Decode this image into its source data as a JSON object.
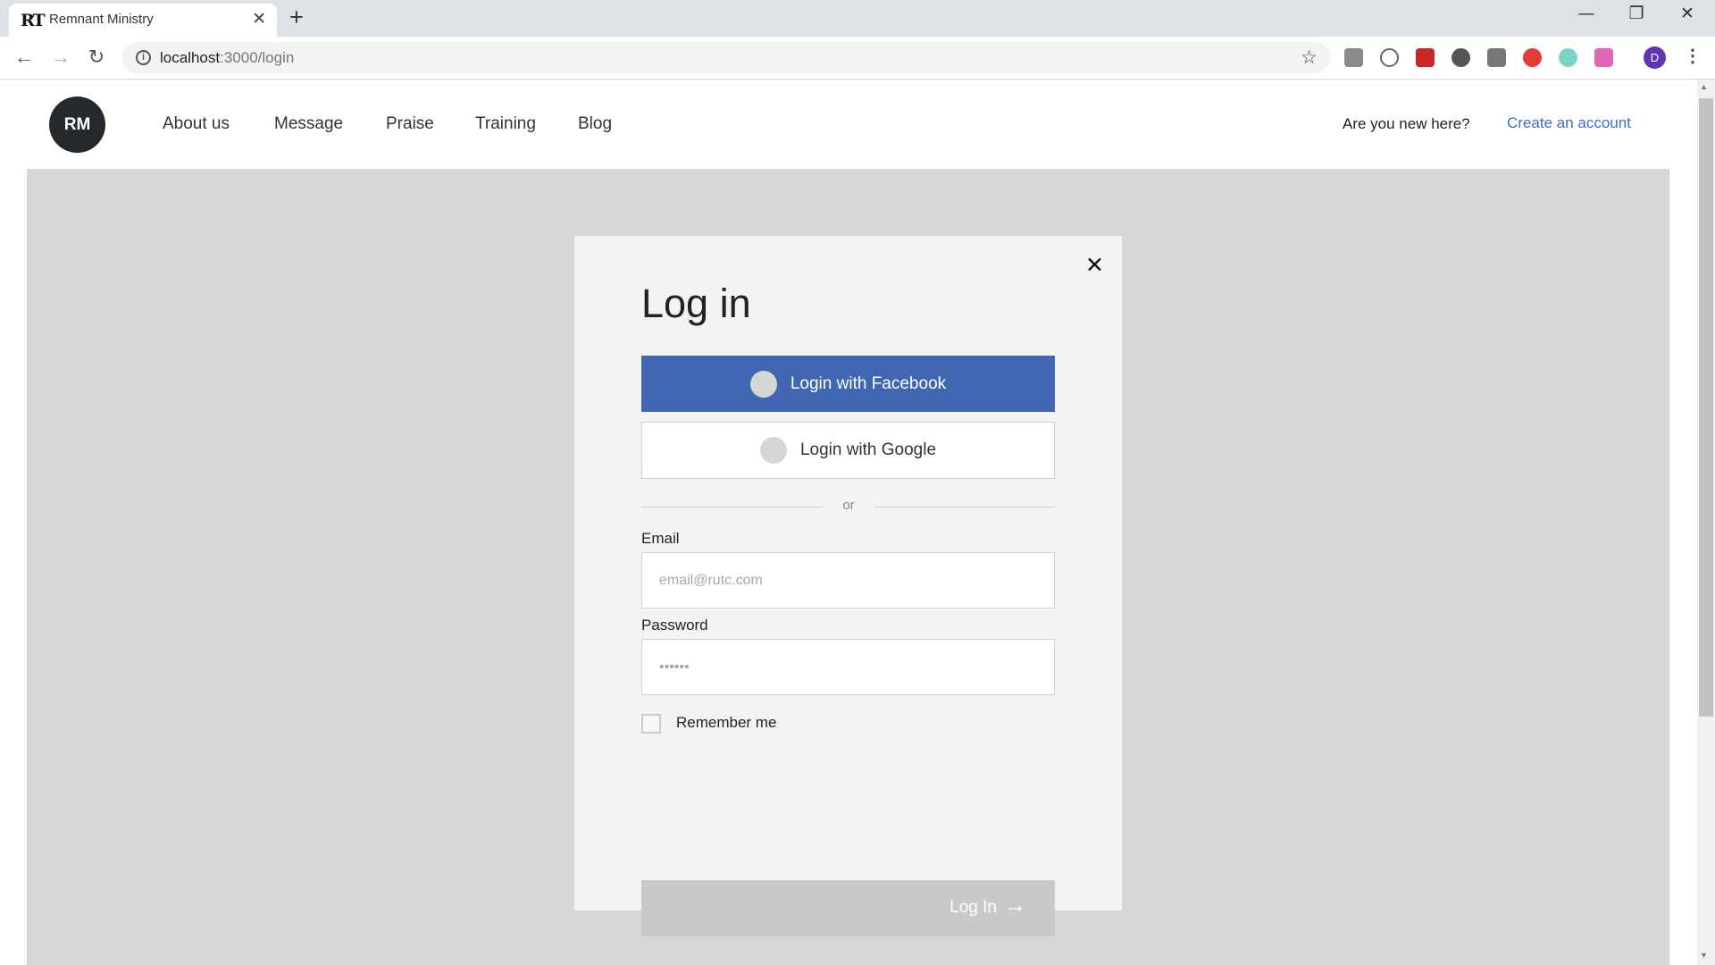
{
  "browser": {
    "tab_title": "Remnant Ministry",
    "favicon": "RT",
    "url_host": "localhost",
    "url_path": ":3000/login",
    "profile_initial": "D",
    "extensions": [
      {
        "name": "es-extension-icon",
        "color": "#8a8a8a"
      },
      {
        "name": "h-extension-icon",
        "color": "#ffffff"
      },
      {
        "name": "red-extension-icon",
        "color": "#c62828"
      },
      {
        "name": "circle-extension-icon",
        "color": "#555555"
      },
      {
        "name": "eyedropper-extension-icon",
        "color": "#777777"
      },
      {
        "name": "opera-extension-icon",
        "color": "#e53935"
      },
      {
        "name": "color-wheel-extension-icon",
        "color": "#7cd3c8"
      },
      {
        "name": "gradient-extension-icon",
        "color": "#e066b6"
      }
    ]
  },
  "header": {
    "logo": "RM",
    "nav": [
      "About us",
      "Message",
      "Praise",
      "Training",
      "Blog"
    ],
    "new_here": "Are you new here?",
    "create_account": "Create an account"
  },
  "modal": {
    "title": "Log in",
    "facebook_label": "Login with Facebook",
    "google_label": "Login with Google",
    "or": "or",
    "email_label": "Email",
    "email_placeholder": "email@rutc.com",
    "password_label": "Password",
    "password_placeholder": "••••••",
    "remember_label": "Remember me",
    "login_label": "Log In"
  },
  "colors": {
    "facebook": "#4267b2",
    "link": "#3b6bc9",
    "logo_bg": "#24292e",
    "backdrop": "#d7d7d7",
    "login_disabled": "#c9c9c9"
  }
}
